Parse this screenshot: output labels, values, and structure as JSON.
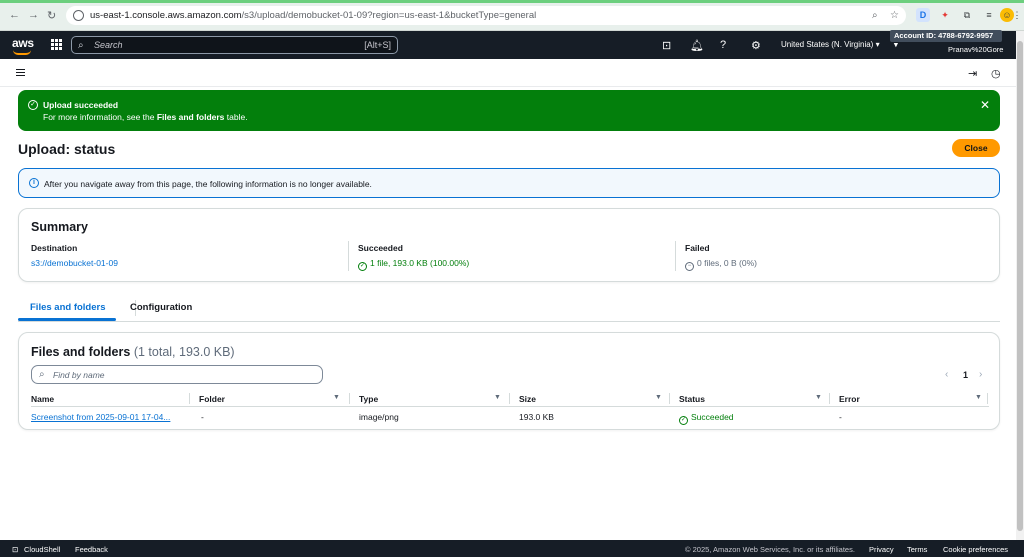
{
  "browser": {
    "url_host": "us-east-1.console.aws.amazon.com",
    "url_path": "/s3/upload/demobucket-01-09?region=us-east-1&bucketType=general"
  },
  "topnav": {
    "logo": "aws",
    "search_placeholder": "Search",
    "search_shortcut": "[Alt+S]",
    "region": "United States (N. Virginia)",
    "account": "Account ID: 4788-6792-9957",
    "user": "Pranav%20Gore"
  },
  "flash": {
    "title": "Upload succeeded",
    "desc_prefix": "For more information, see the ",
    "desc_link": "Files and folders",
    "desc_suffix": " table."
  },
  "page": {
    "title": "Upload: status",
    "close_label": "Close",
    "info": "After you navigate away from this page, the following information is no longer available."
  },
  "summary": {
    "heading": "Summary",
    "destination_label": "Destination",
    "destination_value": "s3://demobucket-01-09",
    "succeeded_label": "Succeeded",
    "succeeded_value": "1 file, 193.0 KB (100.00%)",
    "failed_label": "Failed",
    "failed_value": "0 files, 0 B (0%)"
  },
  "tabs": [
    {
      "label": "Files and folders"
    },
    {
      "label": "Configuration"
    }
  ],
  "files": {
    "heading": "Files and folders",
    "count": "(1 total, 193.0 KB)",
    "find_placeholder": "Find by name",
    "page": "1",
    "columns": [
      "Name",
      "Folder",
      "Type",
      "Size",
      "Status",
      "Error"
    ],
    "rows": [
      {
        "name": "Screenshot from 2025-09-01 17-04...",
        "folder": "-",
        "type": "image/png",
        "size": "193.0 KB",
        "status": "Succeeded",
        "error": "-"
      }
    ]
  },
  "footer": {
    "cloudshell": "CloudShell",
    "feedback": "Feedback",
    "copyright": "© 2025, Amazon Web Services, Inc. or its affiliates.",
    "privacy": "Privacy",
    "terms": "Terms",
    "cookies": "Cookie preferences"
  }
}
